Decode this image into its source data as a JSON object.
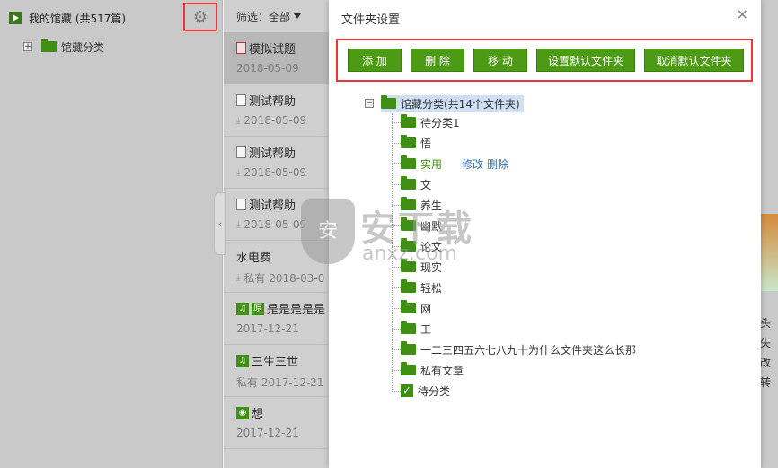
{
  "sidebar": {
    "title": "我的馆藏 (共517篇)",
    "root_folder": "馆藏分类",
    "expander": "+",
    "gear": "⚙"
  },
  "list": {
    "filter_label": "筛选：",
    "filter_value": "全部",
    "items": [
      {
        "title": "模拟试题",
        "date": "2018-05-09",
        "icon": "doc-red-icon"
      },
      {
        "title": "测试帮助",
        "date": "2018-05-09",
        "icon": "doc-icon"
      },
      {
        "title": "测试帮助",
        "date": "2018-05-09",
        "icon": "doc-icon"
      },
      {
        "title": "测试帮助",
        "date": "2018-05-09",
        "icon": "doc-icon"
      },
      {
        "title": "水电费",
        "date": "私有 2018-03-0",
        "icon": ""
      },
      {
        "title": "是是是是是",
        "date": "2017-12-21",
        "icon": "music-icon",
        "tag": "原"
      },
      {
        "title": "三生三世",
        "date": "私有 2017-12-21",
        "icon": "music-icon"
      },
      {
        "title": "想",
        "date": "2017-12-21",
        "icon": "film-icon"
      }
    ]
  },
  "right_peek": {
    "line1": "头失",
    "line2": "改转"
  },
  "dialog": {
    "title": "文件夹设置",
    "close": "×",
    "buttons": {
      "add": "添 加",
      "delete": "删 除",
      "move": "移 动",
      "set_default": "设置默认文件夹",
      "unset_default": "取消默认文件夹"
    },
    "tree": {
      "root_expander": "−",
      "root_label": "馆藏分类(共14个文件夹)",
      "children": [
        "待分类1",
        "悟",
        "实用",
        "文",
        "养生",
        "幽默",
        "论文",
        "现实",
        "轻松",
        "网",
        "工",
        "一二三四五六七八九十为什么文件夹这么长那",
        "私有文章",
        "待分类"
      ],
      "edit": "修改",
      "remove": "删除"
    }
  },
  "watermark": {
    "big": "安下载",
    "small": "anxz.com",
    "shield": "安"
  }
}
